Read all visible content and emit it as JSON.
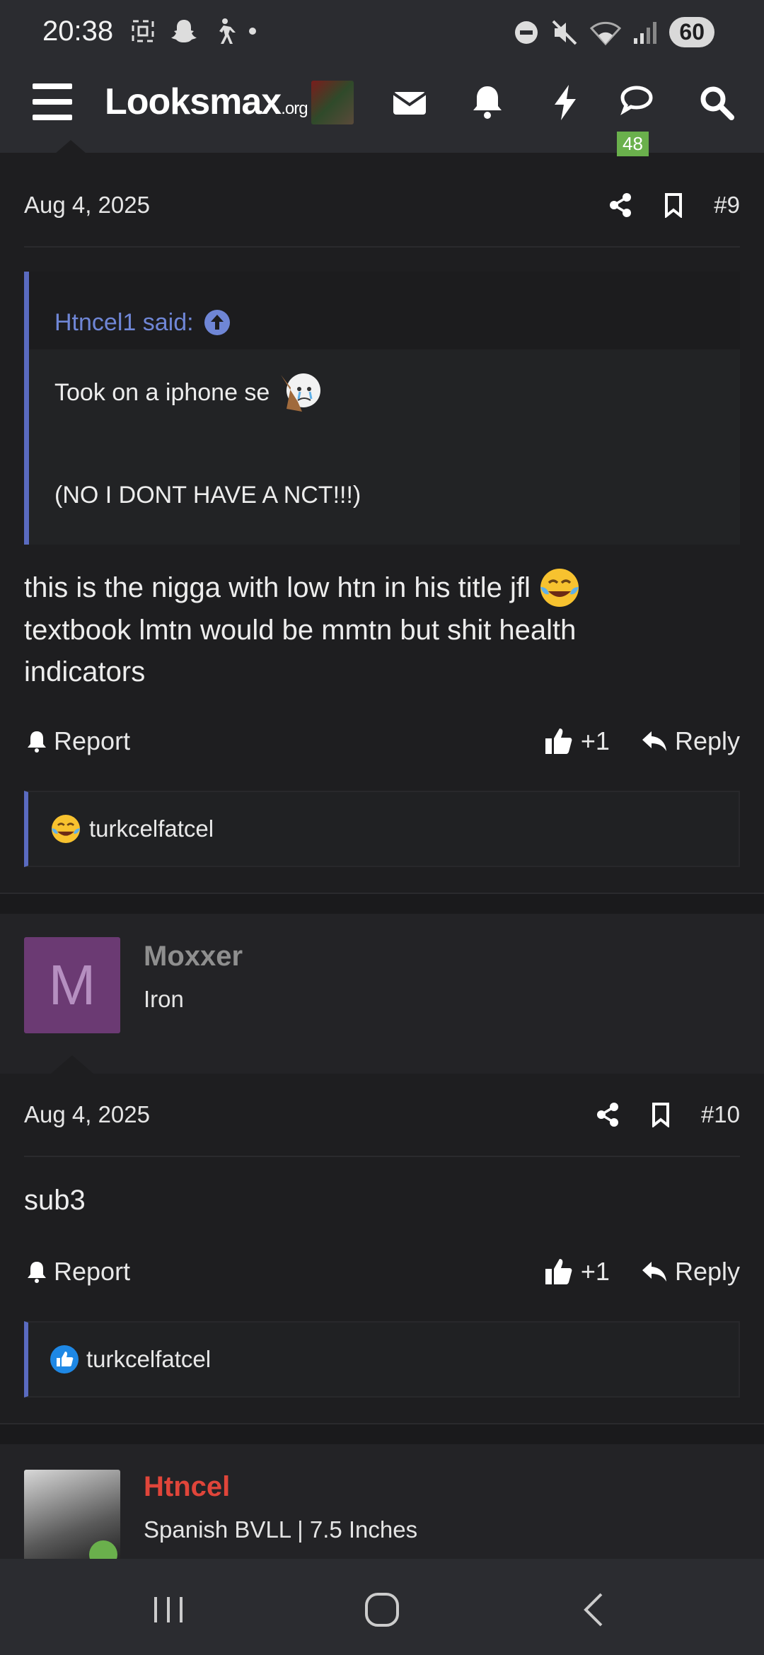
{
  "status_bar": {
    "time": "20:38",
    "battery": "60"
  },
  "header": {
    "logo_main": "Looksmax",
    "logo_suffix": ".org",
    "badge_count": "48",
    "icons": [
      "menu-icon",
      "avatar",
      "mail-icon",
      "bell-icon",
      "lightning-icon",
      "chat-icon",
      "search-icon"
    ]
  },
  "posts": [
    {
      "date": "Aug 4, 2025",
      "number": "#9",
      "quote_author": "Htncel1 said:",
      "quote_line1": "Took on a iphone se",
      "quote_line2": "(NO I DONT HAVE A NCT!!!)",
      "text_line1": "this is the nigga with low htn in his title jfl",
      "text_line2": "textbook lmtn would be mmtn but shit health",
      "text_line3": "indicators",
      "report": "Report",
      "like_count": "+1",
      "reply": "Reply",
      "reaction_user": "turkcelfatcel"
    },
    {
      "user_name": "Moxxer",
      "user_initial": "M",
      "user_title": "Iron",
      "date": "Aug 4, 2025",
      "number": "#10",
      "text": "sub3",
      "report": "Report",
      "like_count": "+1",
      "reply": "Reply",
      "reaction_user": "turkcelfatcel"
    },
    {
      "user_name": "Htncel",
      "user_title": "Spanish BVLL | 7.5 Inches"
    }
  ],
  "colors": {
    "accent_blue": "#5a6bc0",
    "moxxer_avatar": "#6b3a73",
    "htncel_name": "#e0453a",
    "badge_green": "#6ab04c"
  }
}
